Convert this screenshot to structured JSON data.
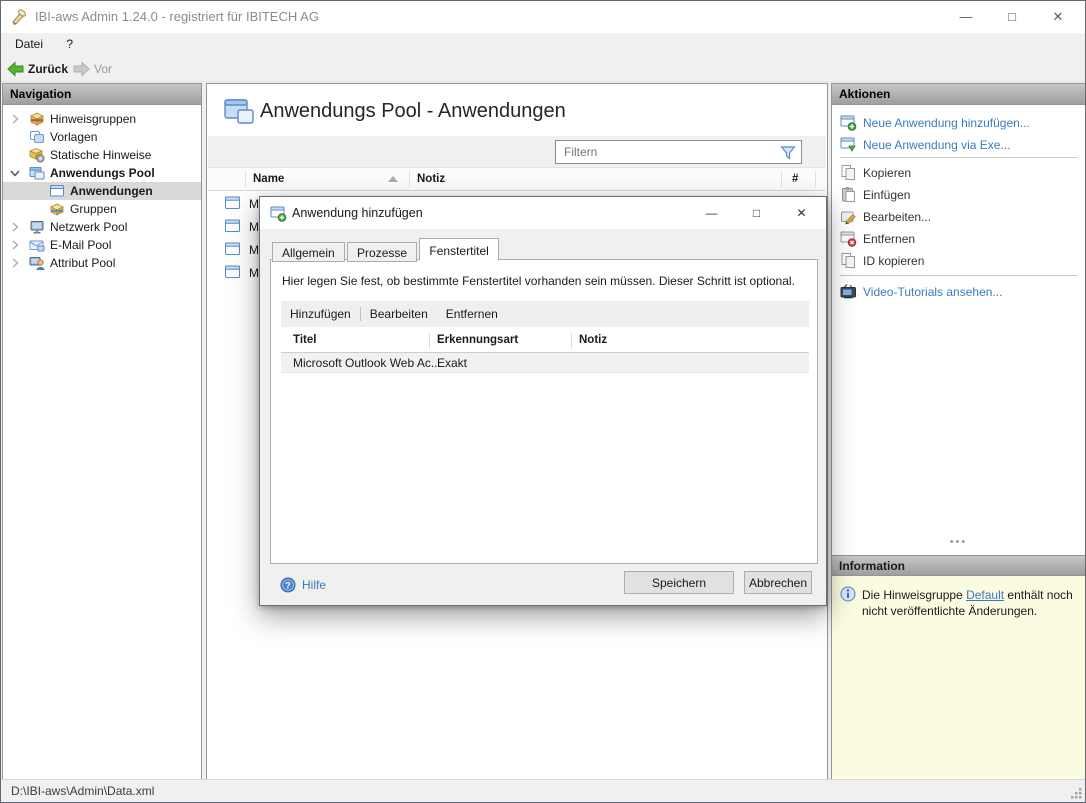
{
  "titlebar": {
    "title": "IBI-aws Admin 1.24.0 - registriert für IBITECH AG",
    "minimize": "—",
    "maximize": "□",
    "close": "✕"
  },
  "menubar": {
    "datei": "Datei",
    "help": "?"
  },
  "toolbar": {
    "back": "Zurück",
    "forward": "Vor"
  },
  "navigation": {
    "header": "Navigation",
    "items": [
      {
        "label": "Hinweisgruppen"
      },
      {
        "label": "Vorlagen"
      },
      {
        "label": "Statische Hinweise"
      },
      {
        "label": "Anwendungs Pool"
      },
      {
        "label": "Anwendungen"
      },
      {
        "label": "Gruppen"
      },
      {
        "label": "Netzwerk Pool"
      },
      {
        "label": "E-Mail Pool"
      },
      {
        "label": "Attribut Pool"
      }
    ]
  },
  "main": {
    "title": "Anwendungs Pool - Anwendungen",
    "filter": {
      "placeholder": "Filtern"
    },
    "table": {
      "columns": {
        "name": "Name",
        "notiz": "Notiz",
        "count": "#"
      },
      "rows": [
        {
          "name": "M"
        },
        {
          "name": "M"
        },
        {
          "name": "M"
        },
        {
          "name": "M"
        }
      ]
    }
  },
  "actions": {
    "header": "Aktionen",
    "new_app": "Neue Anwendung hinzufügen...",
    "new_app_exe": "Neue Anwendung via Exe...",
    "copy": "Kopieren",
    "paste": "Einfügen",
    "edit": "Bearbeiten...",
    "remove": "Entfernen",
    "copy_id": "ID kopieren",
    "video": "Video-Tutorials ansehen..."
  },
  "information": {
    "header": "Information",
    "text_before": "Die Hinweisgruppe ",
    "link": "Default",
    "text_after": " enthält noch nicht veröffentlichte Änderungen."
  },
  "dialog": {
    "title": "Anwendung hinzufügen",
    "minimize": "—",
    "maximize": "□",
    "close": "✕",
    "tabs": [
      "Allgemein",
      "Prozesse",
      "Fenstertitel"
    ],
    "description": "Hier legen Sie fest, ob bestimmte Fenstertitel vorhanden sein müssen. Dieser Schritt ist optional.",
    "toolstrip": {
      "add": "Hinzufügen",
      "edit": "Bearbeiten",
      "remove": "Entfernen"
    },
    "table": {
      "columns": {
        "titel": "Titel",
        "erkennungsart": "Erkennungsart",
        "notiz": "Notiz"
      },
      "rows": [
        {
          "titel": "Microsoft Outlook Web Ac...",
          "erkennungsart": "Exakt",
          "notiz": ""
        }
      ]
    },
    "help": "Hilfe",
    "save": "Speichern",
    "cancel": "Abbrechen"
  },
  "statusbar": {
    "path": "D:\\IBI-aws\\Admin\\Data.xml"
  },
  "colors": {
    "accent_blue": "#3B7BC0",
    "info_bg": "#FBFBE1",
    "selection": "#D9D9D9"
  }
}
